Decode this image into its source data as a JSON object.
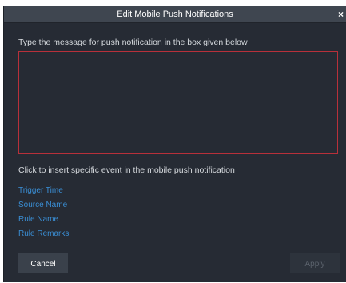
{
  "dialog": {
    "title": "Edit Mobile Push Notifications",
    "close_glyph": "×",
    "instruction": "Type the message for push notification in the box given below",
    "message_value": "",
    "insert_label": "Click to insert specific event in the mobile push notification",
    "events": [
      {
        "label": "Trigger Time"
      },
      {
        "label": "Source Name"
      },
      {
        "label": "Rule Name"
      },
      {
        "label": "Rule Remarks"
      }
    ],
    "cancel_label": "Cancel",
    "apply_label": "Apply"
  },
  "colors": {
    "dialog_background": "#262b34",
    "titlebar_background": "#3f4650",
    "textbox_border": "#b8303a",
    "link_color": "#3a8fd6"
  }
}
